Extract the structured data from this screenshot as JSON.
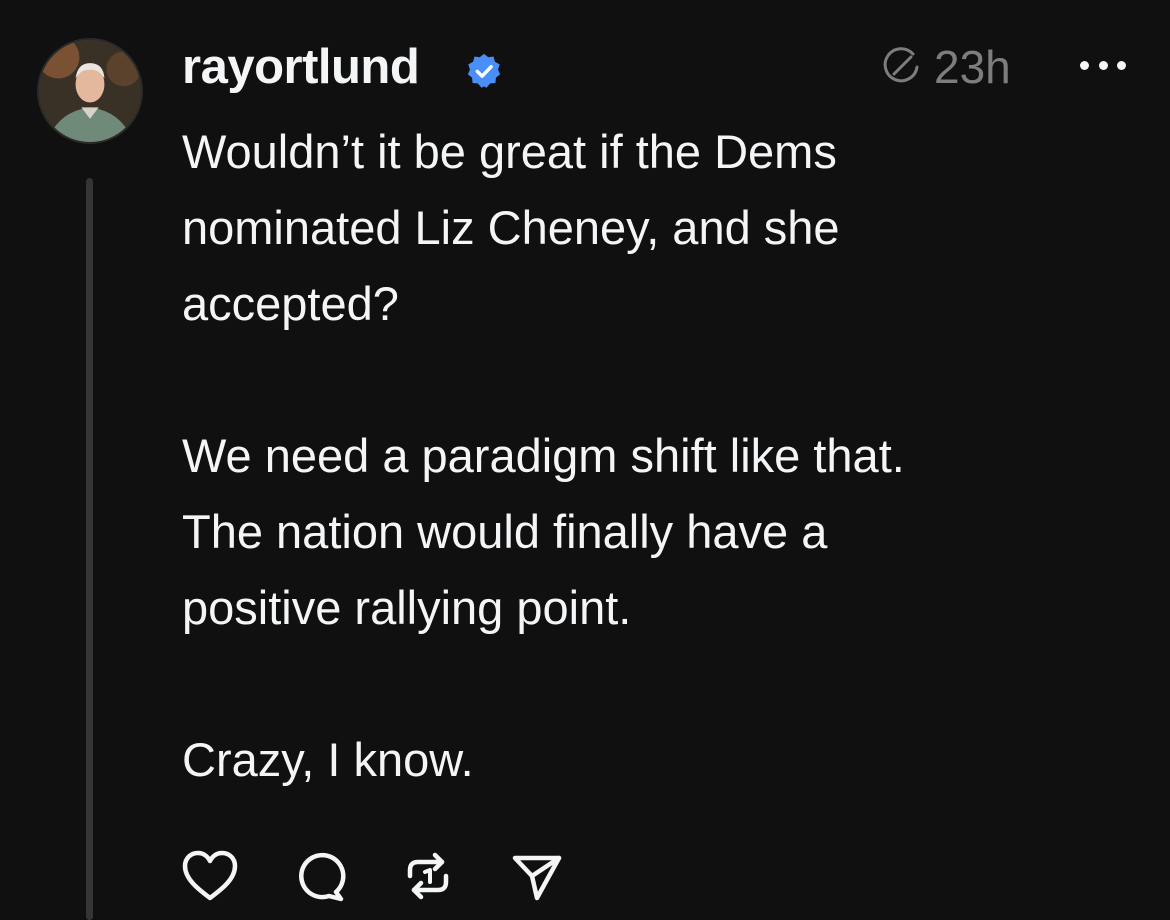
{
  "post": {
    "username": "rayortlund",
    "verified": true,
    "timestamp": "23h",
    "body_paragraphs": [
      [
        "Wouldn’t it be great if the Dems",
        "nominated Liz Cheney, and she",
        "accepted?"
      ],
      [
        "We need a paradigm shift like that.",
        "The nation would finally have a",
        "positive rallying point."
      ],
      [
        "Crazy, I know."
      ]
    ]
  },
  "icons": {
    "verified": "verified-badge-icon",
    "timestamp": "edited-clock-icon",
    "more": "more-options-icon",
    "like": "heart-icon",
    "reply": "comment-bubble-icon",
    "repost": "repost-icon",
    "share": "send-icon"
  },
  "colors": {
    "background": "#101010",
    "text": "#f3f5f7",
    "muted": "#7d7d7d",
    "verified": "#4a8ff7",
    "thread_line": "#353535"
  }
}
